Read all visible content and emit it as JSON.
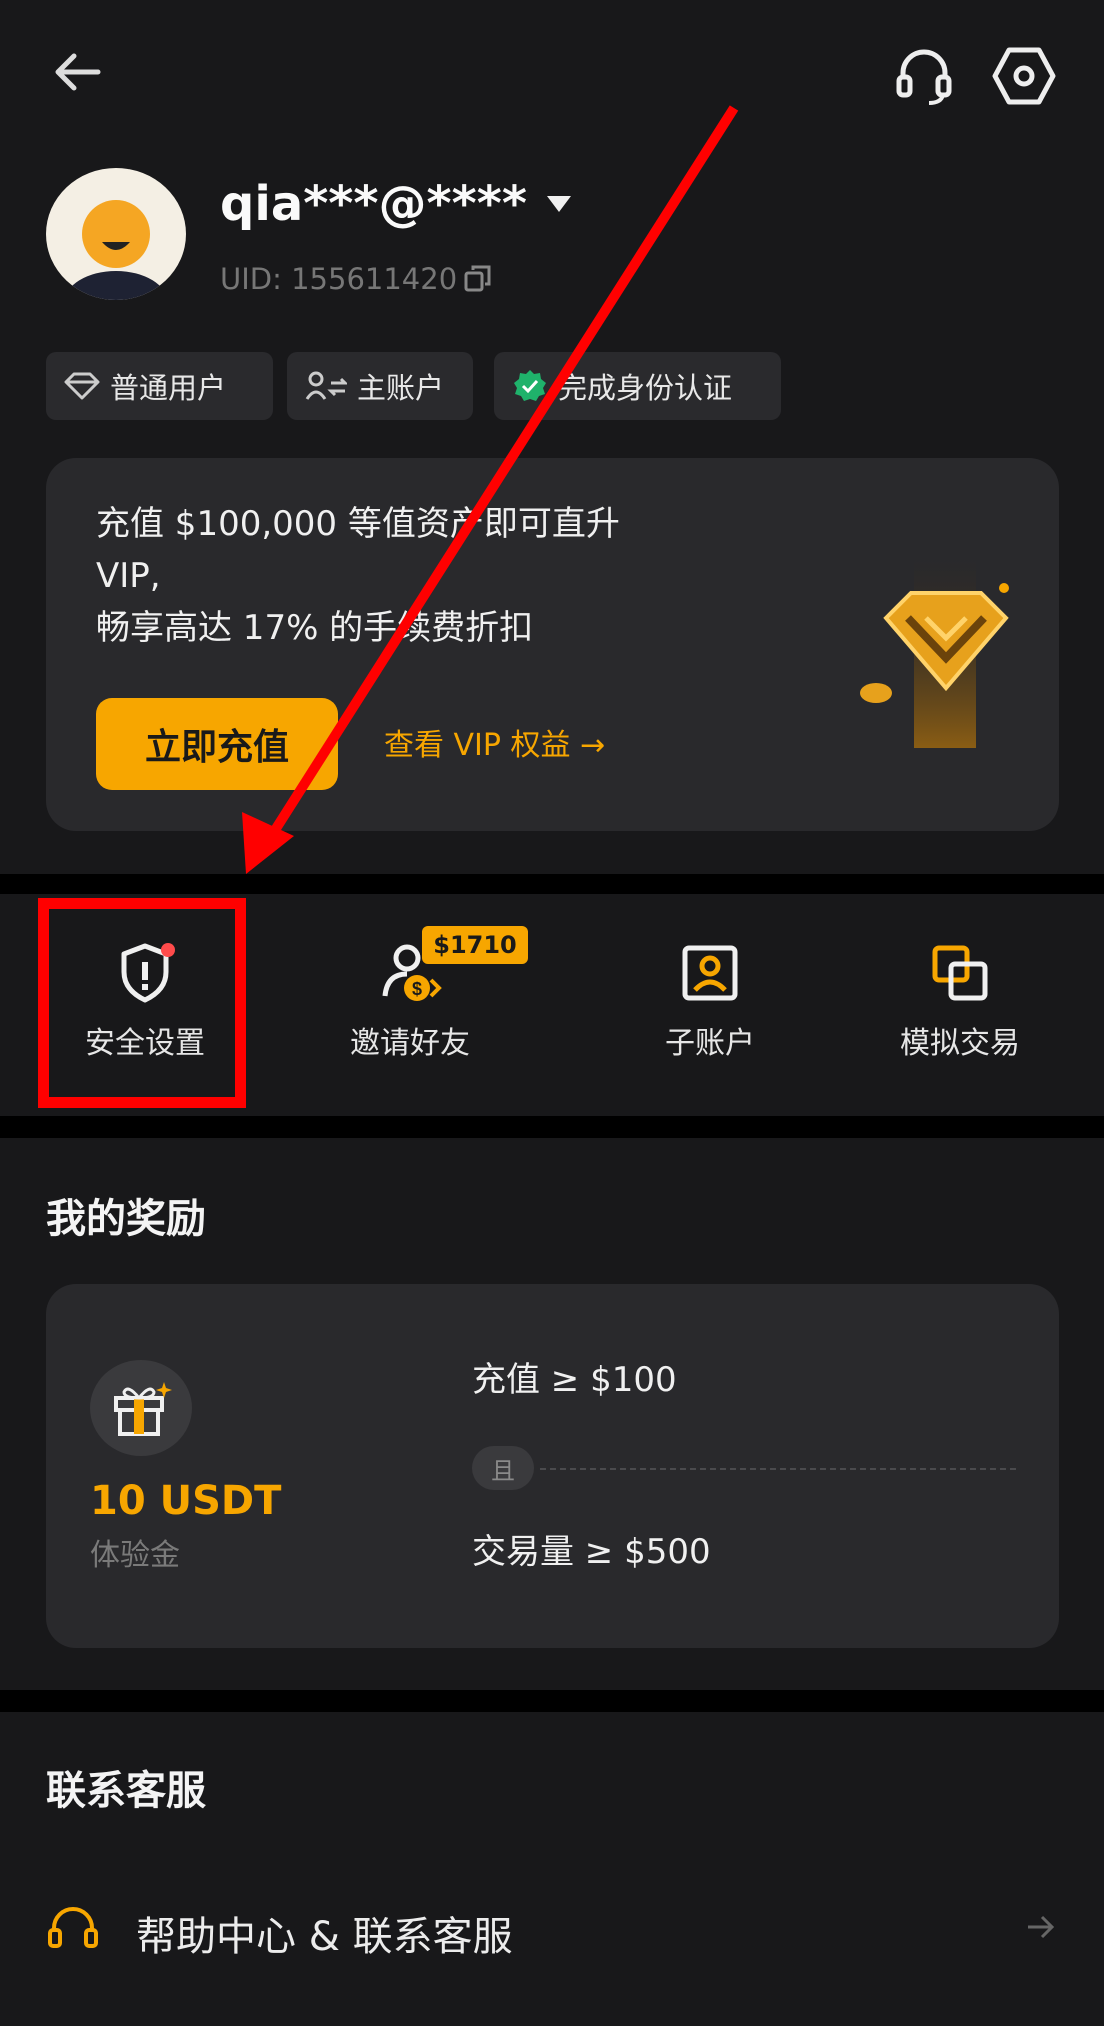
{
  "header": {
    "back_icon": "arrow-left-icon",
    "support_icon": "headset-icon",
    "settings_icon": "hexagon-gear-icon"
  },
  "profile": {
    "name": "qia***@****",
    "uid": "UID: 155611420"
  },
  "tags": [
    {
      "label": "普通用户",
      "icon": "diamond-icon"
    },
    {
      "label": "主账户",
      "icon": "user-switch-icon"
    },
    {
      "label": "完成身份认证",
      "icon": "verified-badge-icon"
    }
  ],
  "vip_card": {
    "line1": "充值 $100,000 等值资产即可直升",
    "line2": "VIP,",
    "line3": "畅享高达 17% 的手续费折扣",
    "deposit_button": "立即充值",
    "vip_link": "查看 VIP 权益 →"
  },
  "shortcuts": [
    {
      "label": "安全设置",
      "icon": "shield-alert-icon"
    },
    {
      "label": "邀请好友",
      "icon": "invite-user-dollar-icon",
      "badge": "$1710"
    },
    {
      "label": "子账户",
      "icon": "sub-account-icon"
    },
    {
      "label": "模拟交易",
      "icon": "demo-trade-icon"
    }
  ],
  "rewards": {
    "title": "我的奖励",
    "amount": "10 USDT",
    "amount_desc": "体验金",
    "cond1": "充值 ≥ $100",
    "and_label": "且",
    "cond2": "交易量 ≥ $500"
  },
  "contact": {
    "title": "联系客服",
    "help_item": "帮助中心 & 联系客服"
  },
  "colors": {
    "accent": "#f7a600",
    "background": "#18181a",
    "card": "#29292c",
    "annotation": "#ff0000"
  }
}
